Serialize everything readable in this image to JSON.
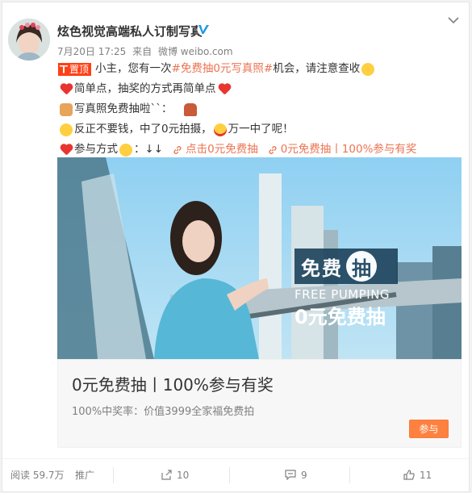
{
  "post": {
    "author": "炫色视觉高端私人订制写真",
    "time": "7月20日 17:25",
    "source_prefix": "来自",
    "source": "微博 weibo.com",
    "pin_label": "置顶",
    "line1_a": "小主，您有一次",
    "line1_tag": "#免费抽0元写真照#",
    "line1_b": "机会，请注意查收",
    "line2": "简单点，抽奖的方式再简单点",
    "line3": "写真照免费抽啦``：",
    "line4_a": "反正不要钱，中了0元拍摄，",
    "line4_b": "万一中了呢！",
    "line5_a": "参与方式",
    "line5_b": "：↓↓",
    "link1": "点击0元免费抽",
    "link2": "0元免费抽丨100%参与有奖"
  },
  "media": {
    "promo_big": "免费",
    "promo_circle": "抽",
    "promo_en": "FREE PUMPING",
    "promo_sub": "0元免费抽"
  },
  "link_card": {
    "title": "0元免费抽丨100%参与有奖",
    "desc": "100%中奖率：价值3999全家福免费拍",
    "button": "参与"
  },
  "footer": {
    "read_label": "阅读 59.7万",
    "promote_label": "推广",
    "forward_count": "10",
    "comment_count": "9",
    "like_count": "11"
  },
  "colors": {
    "accent": "#eb7350",
    "pin_bg": "#ff3f15",
    "button_bg": "#ff8140",
    "promo_bg": "#20465e"
  },
  "icons": [
    "verified-badge-icon",
    "chevron-down-icon",
    "pin-icon",
    "link-chain-icon",
    "forward-icon",
    "comment-icon",
    "like-icon"
  ]
}
